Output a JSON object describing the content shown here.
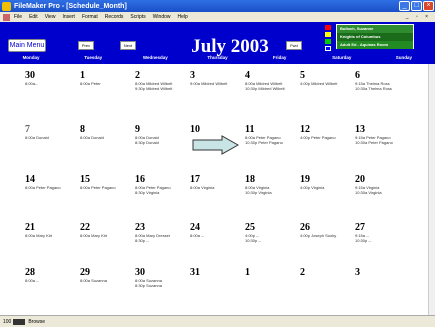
{
  "window": {
    "title": "FileMaker Pro - [Schedule_Month]",
    "minimize": "_",
    "maximize": "□",
    "close": "×"
  },
  "menu": [
    "File",
    "Edit",
    "View",
    "Insert",
    "Format",
    "Records",
    "Scripts",
    "Window",
    "Help"
  ],
  "menu_mdi_controls": "_ ▫ ×",
  "header": {
    "main_menu_label": "Main Menu",
    "prev_label": "Prev",
    "next_label": "Next",
    "forward_label": "Fwd",
    "month_title": "July 2003",
    "legend": [
      {
        "label": "Bulloch, Suzanne",
        "color": "#2e8b2e"
      },
      {
        "label": "Knights of Columbus",
        "color": "#1a6b1a"
      },
      {
        "label": "Adult Ed - Aquinas Room",
        "color": "#228b22"
      }
    ],
    "swatch_colors": [
      "#ff0000",
      "#ffff00",
      "#00cc00",
      "#0000ff"
    ]
  },
  "weekdays": [
    "Monday",
    "Tuesday",
    "Wednesday",
    "Thursday",
    "Friday",
    "Saturday",
    "Sunday"
  ],
  "weeks": [
    [
      {
        "day": "30",
        "faded": false,
        "events": [
          "8:00a--"
        ]
      },
      {
        "day": "1",
        "faded": false,
        "events": [
          "8:00a Peter"
        ]
      },
      {
        "day": "2",
        "faded": false,
        "events": [
          "8:00a Mildred Wilbelt",
          "9:30p Mildred Wilbelt"
        ]
      },
      {
        "day": "3",
        "faded": false,
        "events": [
          "9:00a Mildred Wilbelt"
        ]
      },
      {
        "day": "4",
        "faded": false,
        "events": [
          "8:00a Mildred Wilbelt",
          "10:30p Mildred Wilbelt"
        ]
      },
      {
        "day": "5",
        "faded": false,
        "events": [
          "4:00p Mildred Wilbelt"
        ]
      },
      {
        "day": "6",
        "faded": false,
        "events": [
          "9:15a Thelma Ross",
          "10:30a Thelma Ross"
        ]
      }
    ],
    [
      {
        "day": "7",
        "faded": true,
        "events": [
          "8:00a Donald"
        ]
      },
      {
        "day": "8",
        "faded": false,
        "events": [
          "8:00a Donald"
        ]
      },
      {
        "day": "9",
        "faded": false,
        "events": [
          "8:00a Donald",
          "8:30p Donald"
        ]
      },
      {
        "day": "10",
        "faded": false,
        "events": []
      },
      {
        "day": "11",
        "faded": false,
        "events": [
          "8:00a Peter Pagano",
          "10:30p Peter Pagano"
        ]
      },
      {
        "day": "12",
        "faded": false,
        "events": [
          "4:00p Peter Pagano"
        ]
      },
      {
        "day": "13",
        "faded": false,
        "events": [
          "9:15a Peter Pagano",
          "10:30a Peter Pagano"
        ]
      }
    ],
    [
      {
        "day": "14",
        "faded": false,
        "events": [
          "8:00a Peter Pagano"
        ]
      },
      {
        "day": "15",
        "faded": false,
        "events": [
          "8:00a Peter Pagano"
        ]
      },
      {
        "day": "16",
        "faded": false,
        "events": [
          "8:00a Peter Pagano",
          "8:30p Virginia"
        ]
      },
      {
        "day": "17",
        "faded": false,
        "events": [
          "8:00a Virginia"
        ]
      },
      {
        "day": "18",
        "faded": false,
        "events": [
          "8:00a Virginia",
          "10:30p Virginia"
        ]
      },
      {
        "day": "19",
        "faded": false,
        "events": [
          "4:00p Virginia"
        ]
      },
      {
        "day": "20",
        "faded": false,
        "events": [
          "9:15a Virginia",
          "10:30a Virginia"
        ]
      }
    ],
    [
      {
        "day": "21",
        "faded": false,
        "events": [
          "8:00a Mary Kirt"
        ]
      },
      {
        "day": "22",
        "faded": false,
        "events": [
          "8:00a Mary Kirt"
        ]
      },
      {
        "day": "23",
        "faded": false,
        "events": [
          "8:00a Mary Dresser",
          "8:30p --"
        ]
      },
      {
        "day": "24",
        "faded": false,
        "events": [
          "8:00a --"
        ]
      },
      {
        "day": "25",
        "faded": false,
        "events": [
          "4:00p --",
          "10:30p --"
        ]
      },
      {
        "day": "26",
        "faded": false,
        "events": [
          "4:00p Joseph Sooky"
        ]
      },
      {
        "day": "27",
        "faded": false,
        "events": [
          "9:15a --",
          "10:30p --"
        ]
      }
    ],
    [
      {
        "day": "28",
        "faded": false,
        "events": [
          "8:00a --"
        ]
      },
      {
        "day": "29",
        "faded": false,
        "events": [
          "8:00a Suzanna"
        ]
      },
      {
        "day": "30",
        "faded": false,
        "events": [
          "8:00a Suzanna",
          "8:30p Suzanna"
        ]
      },
      {
        "day": "31",
        "faded": false,
        "events": []
      },
      {
        "day": "1",
        "faded": false,
        "events": []
      },
      {
        "day": "2",
        "faded": false,
        "events": []
      },
      {
        "day": "3",
        "faded": false,
        "events": []
      }
    ]
  ],
  "status": {
    "zoom": "100",
    "mode": "Browse"
  }
}
